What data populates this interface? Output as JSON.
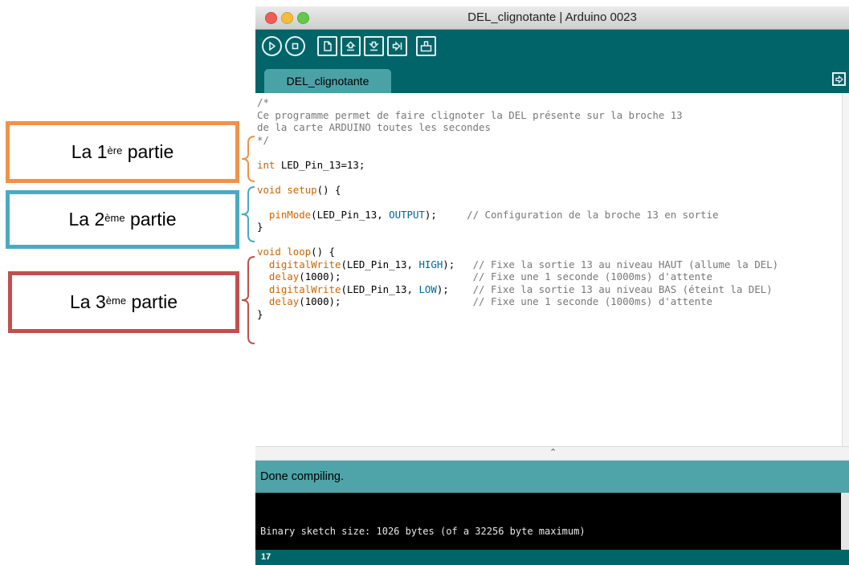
{
  "annotations": [
    {
      "prefix": "La 1",
      "sup": "ère",
      "suffix": " partie",
      "color": "#f0924a"
    },
    {
      "prefix": "La 2",
      "sup": "ème",
      "suffix": " partie",
      "color": "#4aaabf"
    },
    {
      "prefix": "La 3",
      "sup": "ème",
      "suffix": " partie",
      "color": "#c0504d"
    }
  ],
  "window": {
    "title": "DEL_clignotante | Arduino 0023",
    "tab_label": "DEL_clignotante",
    "toolbar_icons": [
      "verify-icon",
      "stop-icon",
      "new-icon",
      "open-icon",
      "save-icon",
      "upload-icon",
      "serial-monitor-icon"
    ],
    "code_lines": [
      "/*",
      "Ce programme permet de faire clignoter la DEL présente sur la broche 13",
      "de la carte ARDUINO toutes les secondes",
      "*/",
      "",
      "int LED_Pin_13=13;",
      "",
      "void setup() {",
      "",
      "  pinMode(LED_Pin_13, OUTPUT);     // Configuration de la broche 13 en sortie",
      "}",
      "",
      "void loop() {",
      "  digitalWrite(LED_Pin_13, HIGH);   // Fixe la sortie 13 au niveau HAUT (allume la DEL)",
      "  delay(1000);                      // Fixe une 1 seconde (1000ms) d'attente",
      "  digitalWrite(LED_Pin_13, LOW);    // Fixe la sortie 13 au niveau BAS (éteint la DEL)",
      "  delay(1000);                      // Fixe une 1 seconde (1000ms) d'attente",
      "}"
    ],
    "status_text": "Done compiling.",
    "console_text": "Binary sketch size: 1026 bytes (of a 32256 byte maximum)",
    "line_number": "17"
  },
  "colors": {
    "toolbar": "#006468",
    "tab": "#4aa1a6",
    "status_bar": "#4ea4a9",
    "comment": "#777777",
    "keyword": "#cc6600",
    "constant": "#006699"
  }
}
